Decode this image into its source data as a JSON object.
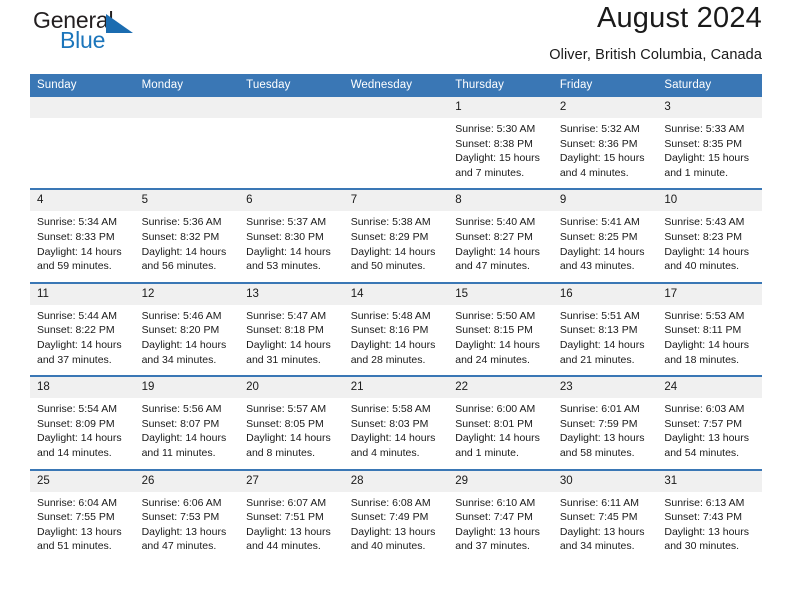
{
  "brand": {
    "word1": "General",
    "word2": "Blue",
    "triangle_color": "#1b6cb0",
    "blue_color": "#1b75bb"
  },
  "header": {
    "title": "August 2024",
    "subtitle": "Oliver, British Columbia, Canada"
  },
  "theme": {
    "header_blue": "#3a77b5",
    "daynum_bg": "#f0f0f0"
  },
  "weekday_headers": [
    "Sunday",
    "Monday",
    "Tuesday",
    "Wednesday",
    "Thursday",
    "Friday",
    "Saturday"
  ],
  "weeks": [
    [
      {
        "day": "",
        "empty": true
      },
      {
        "day": "",
        "empty": true
      },
      {
        "day": "",
        "empty": true
      },
      {
        "day": "",
        "empty": true
      },
      {
        "day": "1",
        "sunrise": "Sunrise: 5:30 AM",
        "sunset": "Sunset: 8:38 PM",
        "daylight1": "Daylight: 15 hours",
        "daylight2": "and 7 minutes."
      },
      {
        "day": "2",
        "sunrise": "Sunrise: 5:32 AM",
        "sunset": "Sunset: 8:36 PM",
        "daylight1": "Daylight: 15 hours",
        "daylight2": "and 4 minutes."
      },
      {
        "day": "3",
        "sunrise": "Sunrise: 5:33 AM",
        "sunset": "Sunset: 8:35 PM",
        "daylight1": "Daylight: 15 hours",
        "daylight2": "and 1 minute."
      }
    ],
    [
      {
        "day": "4",
        "sunrise": "Sunrise: 5:34 AM",
        "sunset": "Sunset: 8:33 PM",
        "daylight1": "Daylight: 14 hours",
        "daylight2": "and 59 minutes."
      },
      {
        "day": "5",
        "sunrise": "Sunrise: 5:36 AM",
        "sunset": "Sunset: 8:32 PM",
        "daylight1": "Daylight: 14 hours",
        "daylight2": "and 56 minutes."
      },
      {
        "day": "6",
        "sunrise": "Sunrise: 5:37 AM",
        "sunset": "Sunset: 8:30 PM",
        "daylight1": "Daylight: 14 hours",
        "daylight2": "and 53 minutes."
      },
      {
        "day": "7",
        "sunrise": "Sunrise: 5:38 AM",
        "sunset": "Sunset: 8:29 PM",
        "daylight1": "Daylight: 14 hours",
        "daylight2": "and 50 minutes."
      },
      {
        "day": "8",
        "sunrise": "Sunrise: 5:40 AM",
        "sunset": "Sunset: 8:27 PM",
        "daylight1": "Daylight: 14 hours",
        "daylight2": "and 47 minutes."
      },
      {
        "day": "9",
        "sunrise": "Sunrise: 5:41 AM",
        "sunset": "Sunset: 8:25 PM",
        "daylight1": "Daylight: 14 hours",
        "daylight2": "and 43 minutes."
      },
      {
        "day": "10",
        "sunrise": "Sunrise: 5:43 AM",
        "sunset": "Sunset: 8:23 PM",
        "daylight1": "Daylight: 14 hours",
        "daylight2": "and 40 minutes."
      }
    ],
    [
      {
        "day": "11",
        "sunrise": "Sunrise: 5:44 AM",
        "sunset": "Sunset: 8:22 PM",
        "daylight1": "Daylight: 14 hours",
        "daylight2": "and 37 minutes."
      },
      {
        "day": "12",
        "sunrise": "Sunrise: 5:46 AM",
        "sunset": "Sunset: 8:20 PM",
        "daylight1": "Daylight: 14 hours",
        "daylight2": "and 34 minutes."
      },
      {
        "day": "13",
        "sunrise": "Sunrise: 5:47 AM",
        "sunset": "Sunset: 8:18 PM",
        "daylight1": "Daylight: 14 hours",
        "daylight2": "and 31 minutes."
      },
      {
        "day": "14",
        "sunrise": "Sunrise: 5:48 AM",
        "sunset": "Sunset: 8:16 PM",
        "daylight1": "Daylight: 14 hours",
        "daylight2": "and 28 minutes."
      },
      {
        "day": "15",
        "sunrise": "Sunrise: 5:50 AM",
        "sunset": "Sunset: 8:15 PM",
        "daylight1": "Daylight: 14 hours",
        "daylight2": "and 24 minutes."
      },
      {
        "day": "16",
        "sunrise": "Sunrise: 5:51 AM",
        "sunset": "Sunset: 8:13 PM",
        "daylight1": "Daylight: 14 hours",
        "daylight2": "and 21 minutes."
      },
      {
        "day": "17",
        "sunrise": "Sunrise: 5:53 AM",
        "sunset": "Sunset: 8:11 PM",
        "daylight1": "Daylight: 14 hours",
        "daylight2": "and 18 minutes."
      }
    ],
    [
      {
        "day": "18",
        "sunrise": "Sunrise: 5:54 AM",
        "sunset": "Sunset: 8:09 PM",
        "daylight1": "Daylight: 14 hours",
        "daylight2": "and 14 minutes."
      },
      {
        "day": "19",
        "sunrise": "Sunrise: 5:56 AM",
        "sunset": "Sunset: 8:07 PM",
        "daylight1": "Daylight: 14 hours",
        "daylight2": "and 11 minutes."
      },
      {
        "day": "20",
        "sunrise": "Sunrise: 5:57 AM",
        "sunset": "Sunset: 8:05 PM",
        "daylight1": "Daylight: 14 hours",
        "daylight2": "and 8 minutes."
      },
      {
        "day": "21",
        "sunrise": "Sunrise: 5:58 AM",
        "sunset": "Sunset: 8:03 PM",
        "daylight1": "Daylight: 14 hours",
        "daylight2": "and 4 minutes."
      },
      {
        "day": "22",
        "sunrise": "Sunrise: 6:00 AM",
        "sunset": "Sunset: 8:01 PM",
        "daylight1": "Daylight: 14 hours",
        "daylight2": "and 1 minute."
      },
      {
        "day": "23",
        "sunrise": "Sunrise: 6:01 AM",
        "sunset": "Sunset: 7:59 PM",
        "daylight1": "Daylight: 13 hours",
        "daylight2": "and 58 minutes."
      },
      {
        "day": "24",
        "sunrise": "Sunrise: 6:03 AM",
        "sunset": "Sunset: 7:57 PM",
        "daylight1": "Daylight: 13 hours",
        "daylight2": "and 54 minutes."
      }
    ],
    [
      {
        "day": "25",
        "sunrise": "Sunrise: 6:04 AM",
        "sunset": "Sunset: 7:55 PM",
        "daylight1": "Daylight: 13 hours",
        "daylight2": "and 51 minutes."
      },
      {
        "day": "26",
        "sunrise": "Sunrise: 6:06 AM",
        "sunset": "Sunset: 7:53 PM",
        "daylight1": "Daylight: 13 hours",
        "daylight2": "and 47 minutes."
      },
      {
        "day": "27",
        "sunrise": "Sunrise: 6:07 AM",
        "sunset": "Sunset: 7:51 PM",
        "daylight1": "Daylight: 13 hours",
        "daylight2": "and 44 minutes."
      },
      {
        "day": "28",
        "sunrise": "Sunrise: 6:08 AM",
        "sunset": "Sunset: 7:49 PM",
        "daylight1": "Daylight: 13 hours",
        "daylight2": "and 40 minutes."
      },
      {
        "day": "29",
        "sunrise": "Sunrise: 6:10 AM",
        "sunset": "Sunset: 7:47 PM",
        "daylight1": "Daylight: 13 hours",
        "daylight2": "and 37 minutes."
      },
      {
        "day": "30",
        "sunrise": "Sunrise: 6:11 AM",
        "sunset": "Sunset: 7:45 PM",
        "daylight1": "Daylight: 13 hours",
        "daylight2": "and 34 minutes."
      },
      {
        "day": "31",
        "sunrise": "Sunrise: 6:13 AM",
        "sunset": "Sunset: 7:43 PM",
        "daylight1": "Daylight: 13 hours",
        "daylight2": "and 30 minutes."
      }
    ]
  ]
}
